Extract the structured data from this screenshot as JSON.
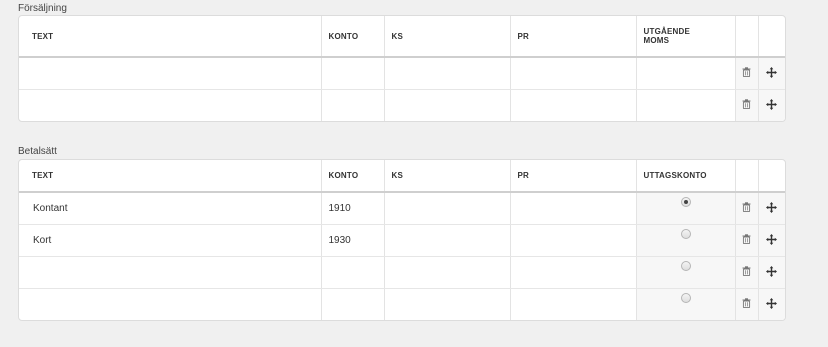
{
  "sales": {
    "title": "Försäljning",
    "columns": [
      "TEXT",
      "KONTO",
      "KS",
      "PR",
      "UTGÅENDE MOMS"
    ],
    "rows": [
      {
        "text": "",
        "account": "",
        "ks": "",
        "pr": "",
        "vat": ""
      },
      {
        "text": "",
        "account": "",
        "ks": "",
        "pr": "",
        "vat": ""
      }
    ]
  },
  "payment": {
    "title": "Betalsätt",
    "columns": [
      "TEXT",
      "KONTO",
      "KS",
      "PR",
      "UTTAGSKONTO"
    ],
    "rows": [
      {
        "text": "Kontant",
        "account": "1910",
        "ks": "",
        "pr": "",
        "withdrawal_selected": true
      },
      {
        "text": "Kort",
        "account": "1930",
        "ks": "",
        "pr": "",
        "withdrawal_selected": false
      },
      {
        "text": "",
        "account": "",
        "ks": "",
        "pr": "",
        "withdrawal_selected": false
      },
      {
        "text": "",
        "account": "",
        "ks": "",
        "pr": "",
        "withdrawal_selected": false
      }
    ]
  },
  "icons": {
    "delete": "trash-icon",
    "move": "move-icon"
  }
}
